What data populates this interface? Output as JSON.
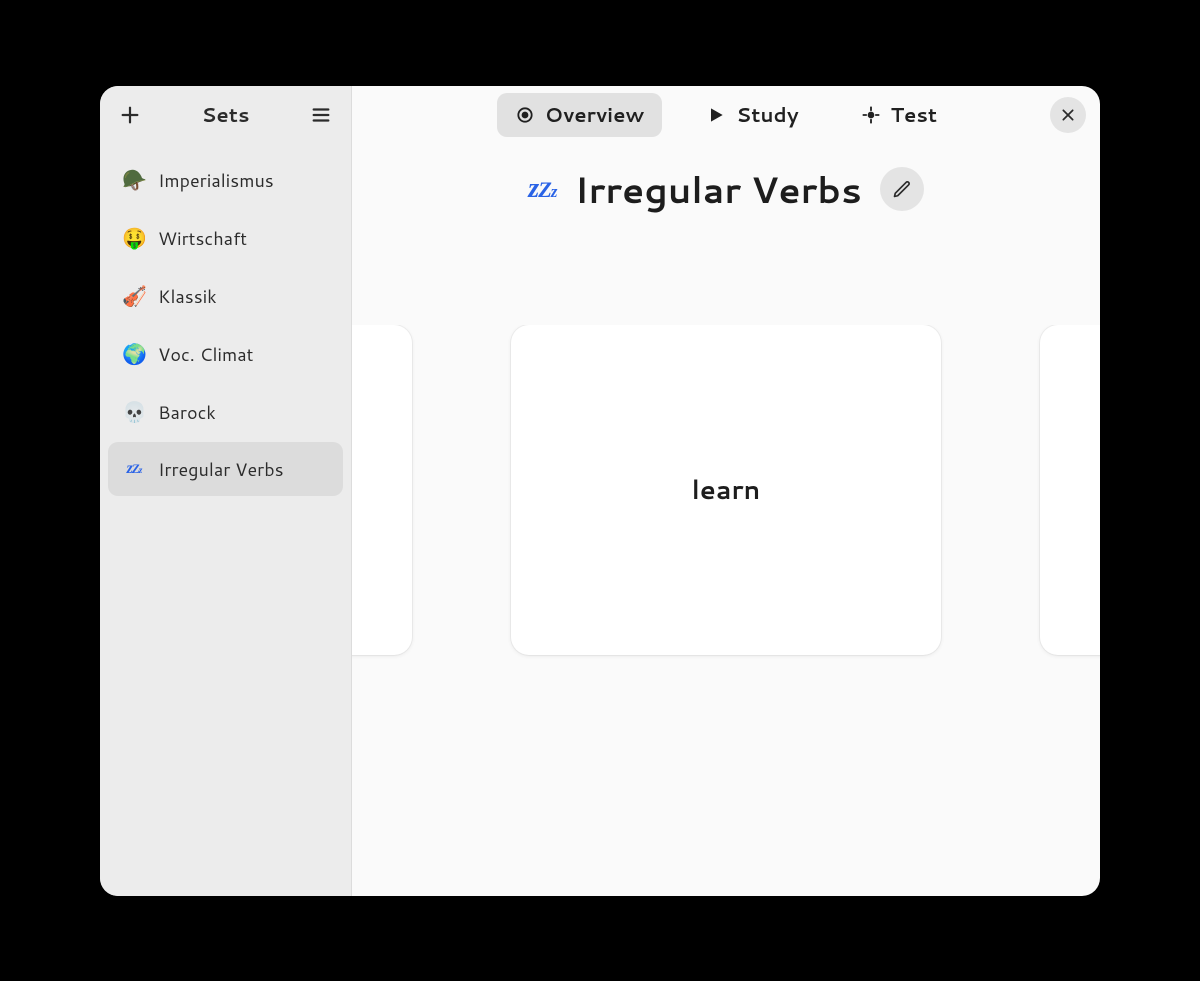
{
  "sidebar": {
    "title": "Sets",
    "items": [
      {
        "emoji": "🪖",
        "label": "Imperialismus"
      },
      {
        "emoji": "🤑",
        "label": "Wirtschaft"
      },
      {
        "emoji": "🎻",
        "label": "Klassik"
      },
      {
        "emoji": "🌍",
        "label": "Voc. Climat"
      },
      {
        "emoji": "💀",
        "label": "Barock"
      },
      {
        "emoji": "sleep",
        "label": "Irregular Verbs"
      }
    ],
    "active_index": 5
  },
  "tabs": {
    "items": [
      {
        "label": "Overview"
      },
      {
        "label": "Study"
      },
      {
        "label": "Test"
      }
    ],
    "active_index": 0
  },
  "title": "Irregular Verbs",
  "card": {
    "front": "learn"
  }
}
